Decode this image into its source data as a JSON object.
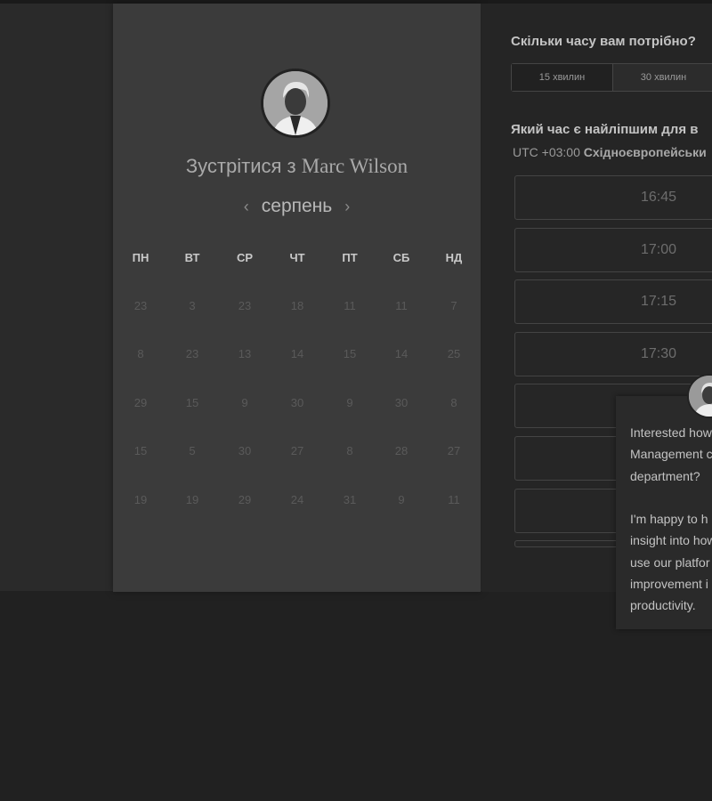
{
  "calendar": {
    "title_prefix": "Зустрітися з",
    "host_name": "Marc Wilson",
    "month": "серпень",
    "prev_arrow": "‹",
    "next_arrow": "›",
    "weekdays": [
      "ПН",
      "ВТ",
      "СР",
      "ЧТ",
      "ПТ",
      "СБ",
      "НД"
    ],
    "weeks": [
      [
        "23",
        "3",
        "23",
        "18",
        "11",
        "11",
        "7"
      ],
      [
        "8",
        "23",
        "13",
        "14",
        "15",
        "14",
        "25"
      ],
      [
        "29",
        "15",
        "9",
        "30",
        "9",
        "30",
        "8"
      ],
      [
        "15",
        "5",
        "30",
        "27",
        "8",
        "28",
        "27"
      ],
      [
        "19",
        "19",
        "29",
        "24",
        "31",
        "9",
        "11"
      ]
    ]
  },
  "booking": {
    "duration_heading": "Скільки часу вам потрібно?",
    "durations": [
      "15 хвилин",
      "30 хвилин"
    ],
    "time_heading": "Який час є найліпшим для в",
    "timezone_offset": "UTC +03:00",
    "timezone_name": "Східноєвропейськи",
    "slots": [
      "16:45",
      "17:00",
      "17:15",
      "17:30",
      "",
      "",
      "",
      ""
    ]
  },
  "chat_popup": {
    "message": "Interested how\nManagement c\ndepartment?\n\nI'm happy to h\ninsight into how\nuse our platfor\nimprovement i\nproductivity."
  },
  "colors": {
    "page_background": "#212121",
    "calendar_panel": "#3b3b3b",
    "booking_panel": "#252525"
  }
}
